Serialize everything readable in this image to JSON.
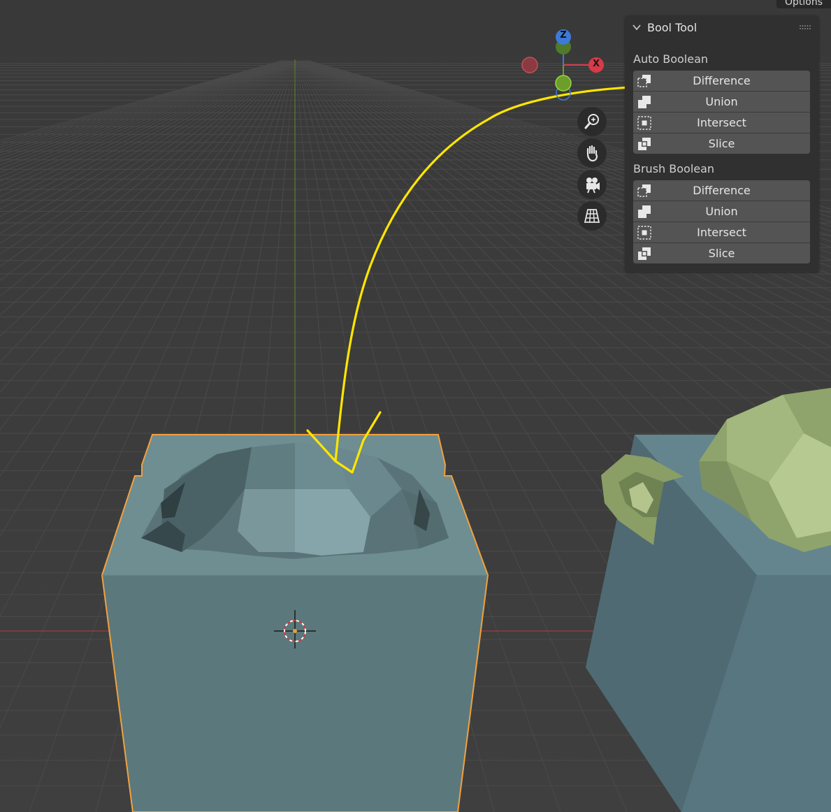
{
  "header": {
    "options_label": "Options"
  },
  "gizmo": {
    "z_label": "Z",
    "x_label": "X"
  },
  "nav_tools": [
    {
      "name": "zoom-icon"
    },
    {
      "name": "pan-hand-icon"
    },
    {
      "name": "camera-icon"
    },
    {
      "name": "perspective-grid-icon"
    }
  ],
  "panel": {
    "title": "Bool Tool",
    "sections": [
      {
        "label": "Auto Boolean",
        "buttons": [
          {
            "label": "Difference",
            "icon": "difference-icon"
          },
          {
            "label": "Union",
            "icon": "union-icon"
          },
          {
            "label": "Intersect",
            "icon": "intersect-icon"
          },
          {
            "label": "Slice",
            "icon": "slice-icon"
          }
        ]
      },
      {
        "label": "Brush Boolean",
        "buttons": [
          {
            "label": "Difference",
            "icon": "difference-icon"
          },
          {
            "label": "Union",
            "icon": "union-icon"
          },
          {
            "label": "Intersect",
            "icon": "intersect-icon"
          },
          {
            "label": "Slice",
            "icon": "slice-icon"
          }
        ]
      }
    ]
  },
  "colors": {
    "viewport_bg": "#3d3d3d",
    "grid_line": "#4a4a4a",
    "x_axis": "#a33a3a",
    "y_axis": "#5e7a35",
    "selection_outline": "#f2a040",
    "mesh_front": "#5b7a7c",
    "mesh_top": "#6d8d91",
    "annotation": "#ffe600",
    "panel_bg": "#303030",
    "button_bg": "#545454"
  }
}
